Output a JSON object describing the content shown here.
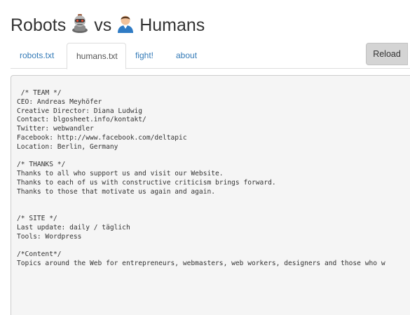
{
  "header": {
    "title_word1": "Robots",
    "title_word2": "vs",
    "title_word3": "Humans",
    "robot_icon": "robot-emoji-icon",
    "human_icon": "human-emoji-icon"
  },
  "tabs": [
    {
      "label": "robots.txt",
      "active": false
    },
    {
      "label": "humans.txt",
      "active": true
    },
    {
      "label": "fight!",
      "active": false
    },
    {
      "label": "about",
      "active": false
    }
  ],
  "toolbar": {
    "reload_label": "Reload"
  },
  "colors": {
    "link": "#337ab7",
    "reload_bg": "#d4d4d4",
    "content_bg": "#f5f5f5"
  },
  "content": {
    "lines": [
      " /* TEAM */",
      "CEO: Andreas Meyhöfer",
      "Creative Director: Diana Ludwig",
      "Contact: blgosheet.info/kontakt/",
      "Twitter: webwandler",
      "Facebook: http://www.facebook.com/deltapic",
      "Location: Berlin, Germany",
      "",
      "/* THANKS */",
      "Thanks to all who support us and visit our Website.",
      "Thanks to each of us with constructive criticism brings forward.",
      "Thanks to those that motivate us again and again.",
      "",
      "",
      "/* SITE */",
      "Last update: daily / täglich",
      "Tools: Wordpress",
      "",
      "/*Content*/",
      "Topics around the Web for entrepreneurs, webmasters, web workers, designers and those who w"
    ]
  }
}
